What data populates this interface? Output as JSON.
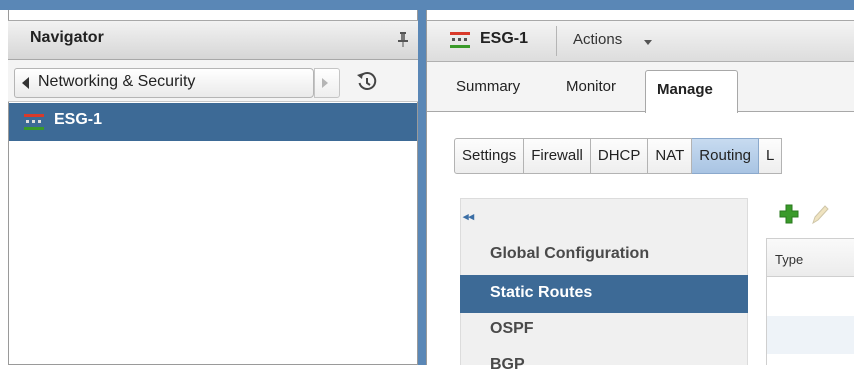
{
  "navigator": {
    "title": "Navigator",
    "back_label": "Networking & Security",
    "items": [
      {
        "label": "ESG-1",
        "selected": true
      }
    ]
  },
  "main": {
    "title": "ESG-1",
    "actions_label": "Actions",
    "tabs": [
      {
        "label": "Summary",
        "active": false
      },
      {
        "label": "Monitor",
        "active": false
      },
      {
        "label": "Manage",
        "active": true
      }
    ],
    "subtabs": [
      {
        "label": "Settings",
        "active": false
      },
      {
        "label": "Firewall",
        "active": false
      },
      {
        "label": "DHCP",
        "active": false
      },
      {
        "label": "NAT",
        "active": false
      },
      {
        "label": "Routing",
        "active": true
      },
      {
        "label": "L",
        "active": false
      }
    ],
    "routing_nav": {
      "collapse_glyph": "◂◂",
      "items": [
        {
          "label": "Global Configuration",
          "selected": false
        },
        {
          "label": "Static Routes",
          "selected": true
        },
        {
          "label": "OSPF",
          "selected": false
        },
        {
          "label": "BGP",
          "selected": false
        }
      ]
    },
    "grid": {
      "columns": [
        "Type"
      ]
    }
  },
  "icons": {
    "pin": "pin-icon",
    "history": "history-icon",
    "edge": "edge-gateway-icon",
    "add": "plus-icon",
    "edit": "pencil-icon"
  },
  "colors": {
    "selection": "#3d6a96",
    "frame": "#5a87b6",
    "active_subtab": "#a9c4e3",
    "add_icon": "#3a9a2a"
  }
}
